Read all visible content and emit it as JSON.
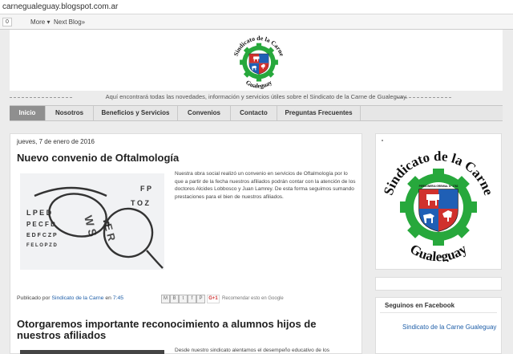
{
  "browser": {
    "url": "carnegualeguay.blogspot.com.ar"
  },
  "navbar": {
    "box": "0",
    "more": "More ▾",
    "next_blog": "Next Blog»"
  },
  "header": {
    "logo_text_top": "Sindicato de la Carne",
    "logo_text_bottom": "Gualeguay",
    "logo_small_text": "PERSONERIA GREMIAL Nº 1762"
  },
  "tagline": "Aquí encontrará todas las novedades, información y servicios útiles sobre el Sindicato de la Carne de Gualeguay.",
  "tabs": [
    {
      "label": "Inicio",
      "active": true
    },
    {
      "label": "Nosotros"
    },
    {
      "label": "Beneficios y Servicios"
    },
    {
      "label": "Convenios"
    },
    {
      "label": "Contacto"
    },
    {
      "label": "Preguntas Frecuentes"
    }
  ],
  "posts": [
    {
      "date": "jueves, 7 de enero de 2016",
      "title": "Nuevo convenio de Oftalmología",
      "body": "Nuestra obra social realizó un convenio en servicios de Oftalmología por lo que a partir de la fecha nuestros afiliados podrán contar con la atención de los doctores Alcides Lobbosco y Juan Lamrey. De esta forma seguimos sumando prestaciones para el bien de nuestros afiliados.",
      "footer_prefix": "Publicado por",
      "author": "Sindicato de la Carne",
      "footer_en": "en",
      "time": "7:45",
      "share_buttons": [
        "M",
        "B",
        "t",
        "f",
        "P"
      ],
      "gplus": "G+1",
      "recommend": "Recomendar esto en Google",
      "eye_chart_rows": [
        "F P",
        "T O Z",
        "L P E D",
        "P E C F D",
        "E D F C Z P",
        "F E L O P Z D"
      ]
    },
    {
      "title": "Otorgaremos importante reconocimiento a alumnos hijos de nuestros afiliados",
      "body": "Desde nuestro sindicato alentamos el desempeño educativo de los"
    }
  ],
  "sidebar": {
    "facebook_title": "Seguinos en Facebook",
    "facebook_link": "Sindicato de la Carne Gualeguay"
  },
  "colors": {
    "gear_green": "#27a83c",
    "shield_blue": "#1f5fb5",
    "shield_red": "#d0312d",
    "tab_active": "#8f8f8f",
    "link": "#1e5ea8"
  },
  "icons": {
    "gear": "gear-icon",
    "shield": "shield-icon",
    "cow": "cow-icon",
    "horse": "horse-icon",
    "rooster": "rooster-icon"
  }
}
